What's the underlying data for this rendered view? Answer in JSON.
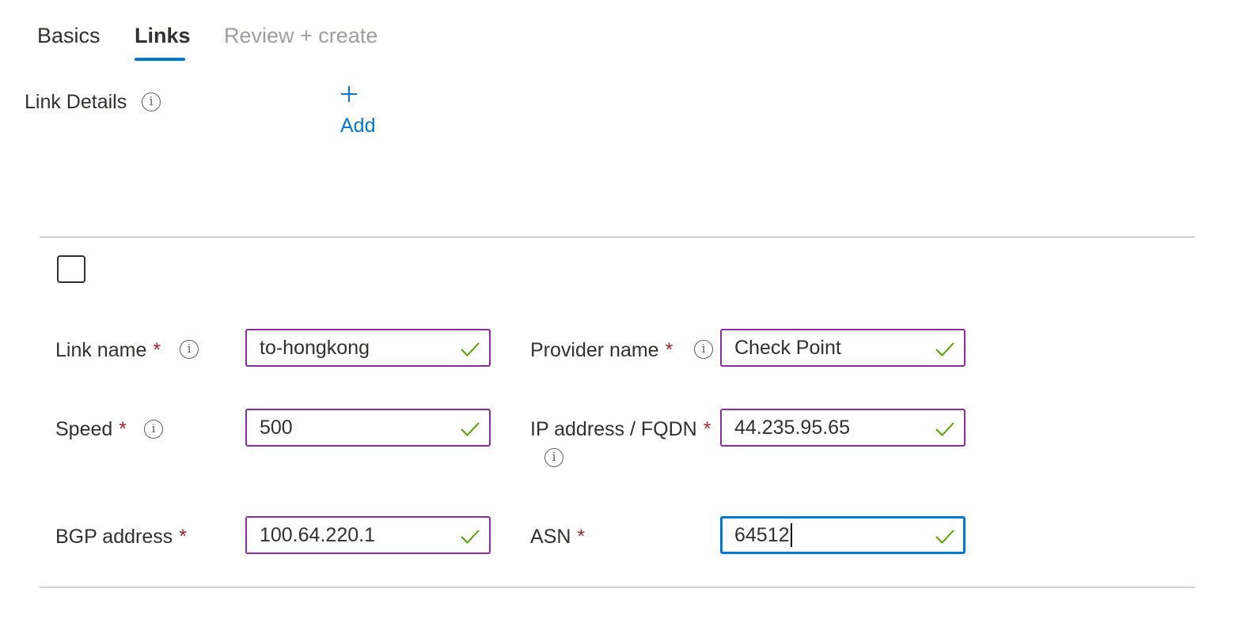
{
  "tabs": [
    {
      "label": "Basics",
      "state": "default"
    },
    {
      "label": "Links",
      "state": "active"
    },
    {
      "label": "Review + create",
      "state": "disabled"
    }
  ],
  "link_details": {
    "label": "Link Details",
    "add_label": "Add"
  },
  "form": {
    "required_marker": "*",
    "link_name": {
      "label": "Link name",
      "value": "to-hongkong"
    },
    "provider_name": {
      "label": "Provider name",
      "value": "Check Point"
    },
    "speed": {
      "label": "Speed",
      "value": "500"
    },
    "ip_address": {
      "label": "IP address / FQDN",
      "value": "44.235.95.65"
    },
    "bgp_address": {
      "label": "BGP address",
      "value": "100.64.220.1"
    },
    "asn": {
      "label": "ASN",
      "value": "64512",
      "focused": true
    }
  },
  "colors": {
    "accent": "#0078d4",
    "input_border": "#8a2b9e",
    "valid_check": "#57a300",
    "required": "#a4262c",
    "disabled_text": "#a19f9d"
  }
}
